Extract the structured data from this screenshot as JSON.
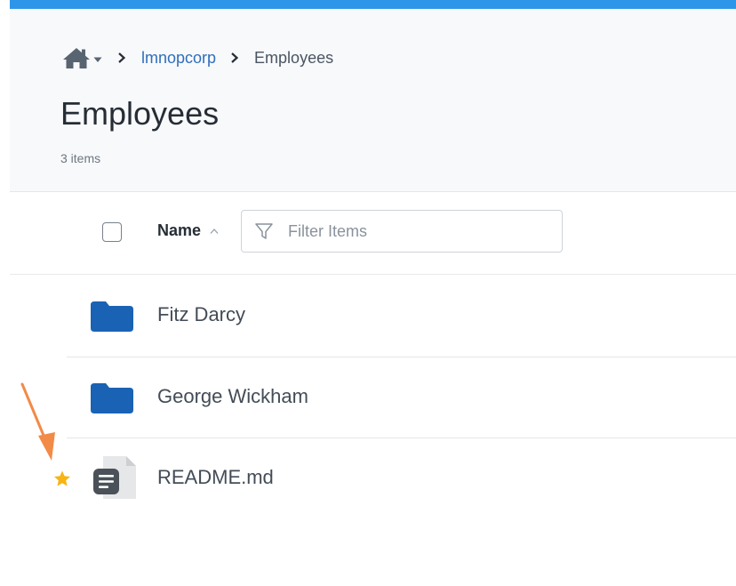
{
  "colors": {
    "top_bar": "#2e96e8",
    "link": "#2f6fbd",
    "folder": "#1a63b4",
    "star": "#f7b414",
    "annotation_arrow": "#f28a48"
  },
  "breadcrumb": {
    "home_icon": "home-icon",
    "dropdown_icon": "caret-down-icon",
    "separator_icon": "chevron-right-icon",
    "items": [
      {
        "label": "lmnopcorp",
        "link": true
      },
      {
        "label": "Employees",
        "link": false
      }
    ]
  },
  "page": {
    "title": "Employees",
    "item_count": "3 items"
  },
  "list_header": {
    "name_label": "Name",
    "sort_icon": "sort-ascending-icon",
    "filter_icon": "filter-icon",
    "filter_placeholder": "Filter Items",
    "filter_value": ""
  },
  "items": [
    {
      "name": "Fitz Darcy",
      "type": "folder",
      "icon": "folder-icon",
      "starred": false
    },
    {
      "name": "George Wickham",
      "type": "folder",
      "icon": "folder-icon",
      "starred": false
    },
    {
      "name": "README.md",
      "type": "file",
      "icon": "document-icon",
      "starred": true
    }
  ],
  "annotation": {
    "icon": "arrow-annotation-icon"
  }
}
